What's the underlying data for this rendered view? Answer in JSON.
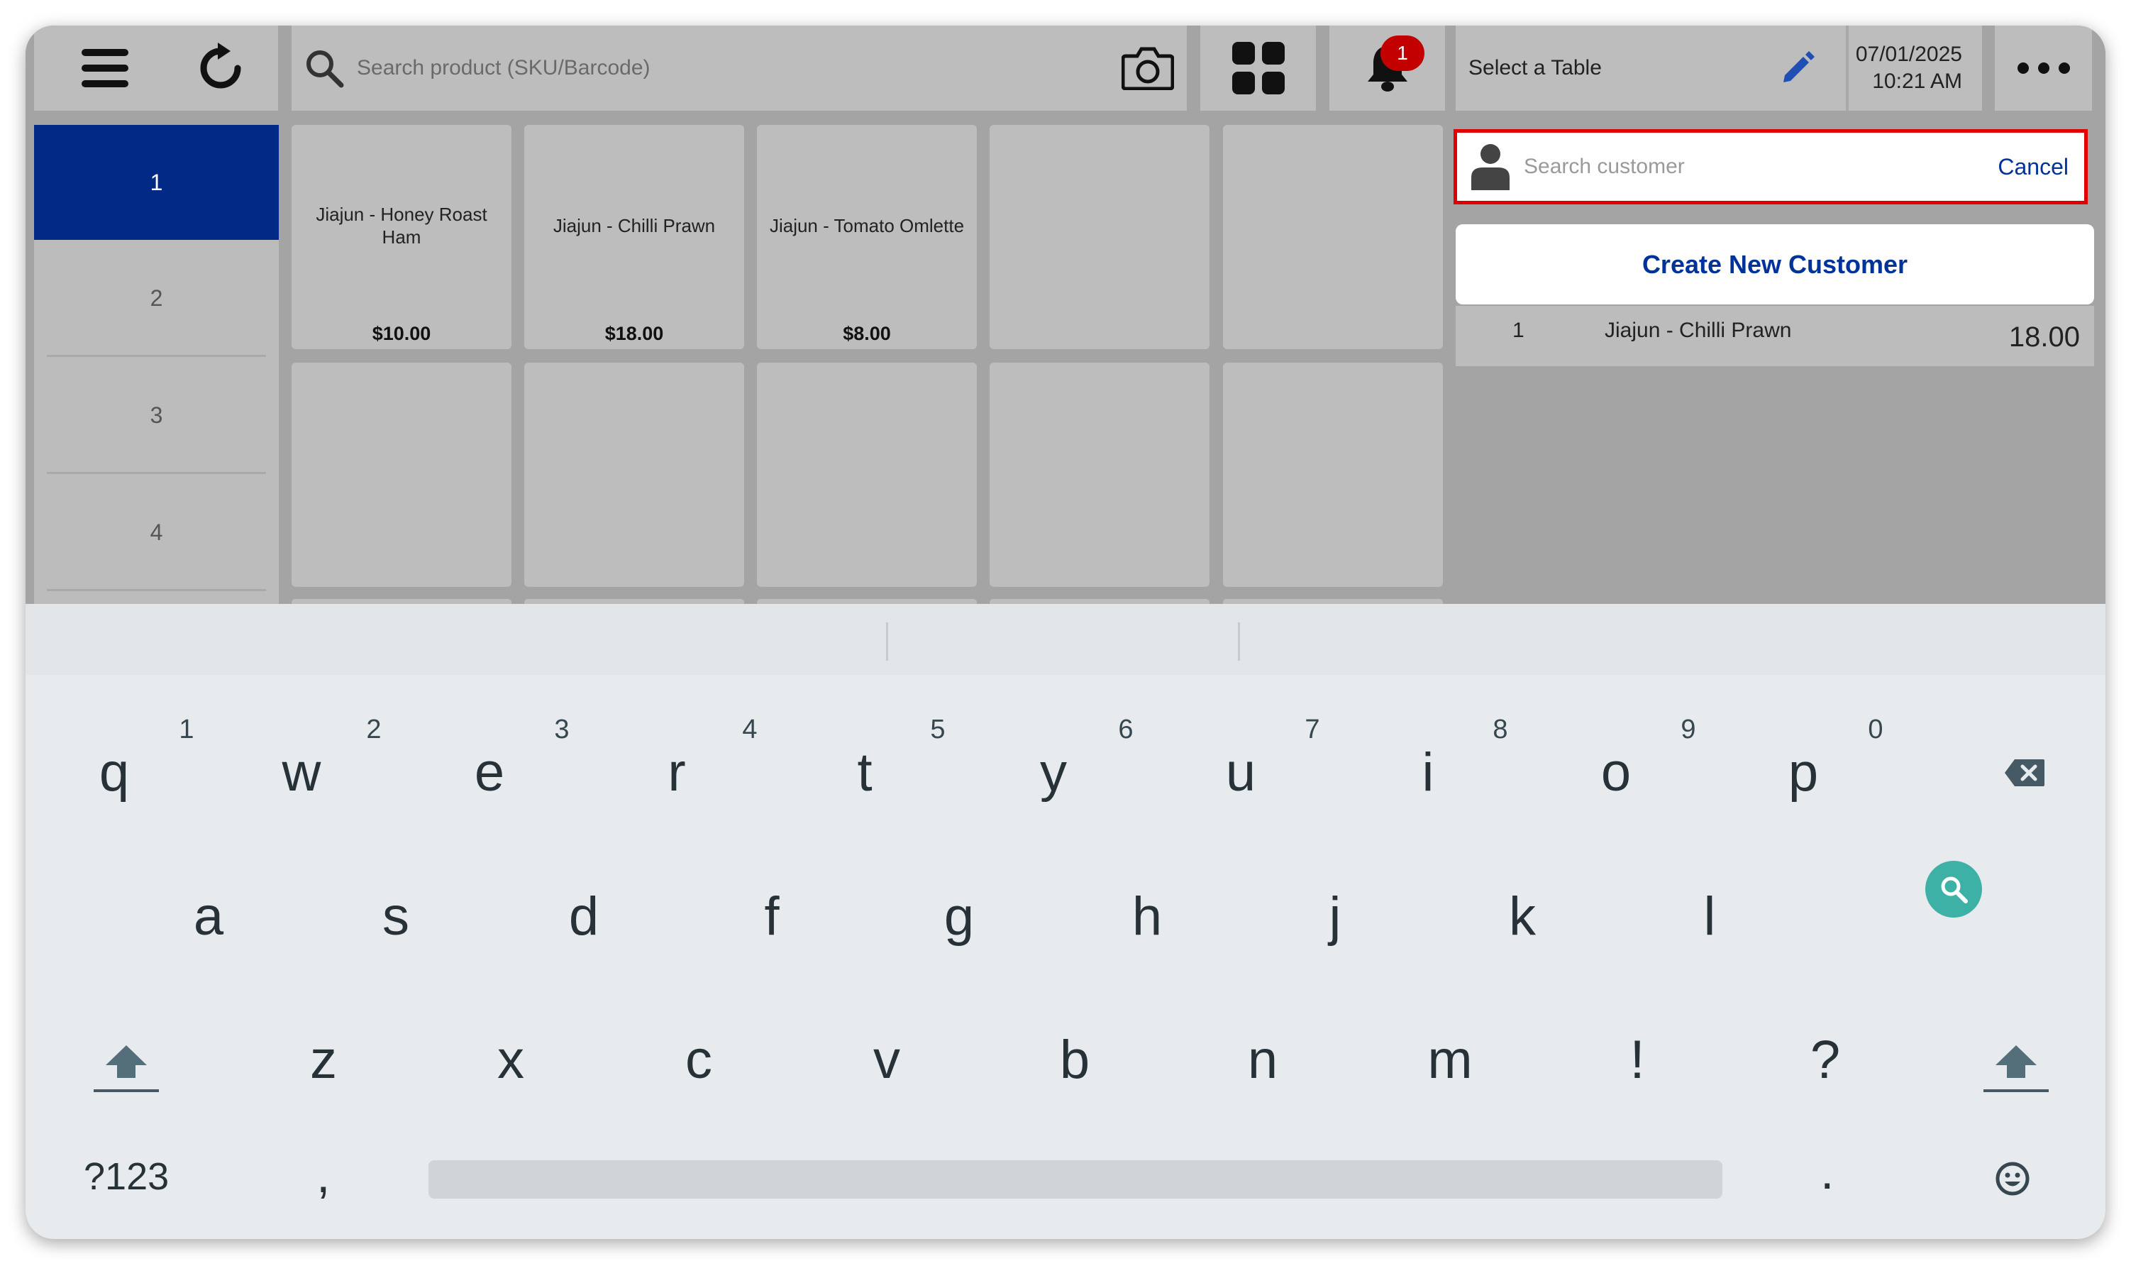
{
  "toolbar": {
    "search_placeholder": "Search product (SKU/Barcode)",
    "notification_count": "1",
    "table_label": "Select a Table",
    "date": "07/01/2025",
    "time": "10:21 AM"
  },
  "categories": [
    "1",
    "2",
    "3",
    "4"
  ],
  "products": [
    {
      "name": "Jiajun - Honey Roast Ham",
      "price": "$10.00"
    },
    {
      "name": "Jiajun - Chilli Prawn",
      "price": "$18.00"
    },
    {
      "name": "Jiajun - Tomato Omlette",
      "price": "$8.00"
    }
  ],
  "order": {
    "qty": "1",
    "item": "Jiajun - Chilli Prawn",
    "amount": "18.00"
  },
  "customer": {
    "search_placeholder": "Search customer",
    "cancel_label": "Cancel",
    "create_label": "Create New Customer"
  },
  "keyboard": {
    "row1": [
      "q",
      "w",
      "e",
      "r",
      "t",
      "y",
      "u",
      "i",
      "o",
      "p"
    ],
    "row1_hints": [
      "1",
      "2",
      "3",
      "4",
      "5",
      "6",
      "7",
      "8",
      "9",
      "0"
    ],
    "row2": [
      "a",
      "s",
      "d",
      "f",
      "g",
      "h",
      "j",
      "k",
      "l"
    ],
    "row3": [
      "z",
      "x",
      "c",
      "v",
      "b",
      "n",
      "m",
      "!",
      "?"
    ],
    "symbols_label": "?123",
    "comma": ",",
    "period": "."
  }
}
